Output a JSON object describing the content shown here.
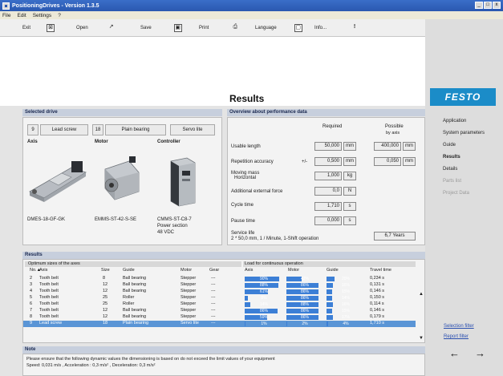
{
  "window": {
    "title": "PositioningDrives - Version 1.3.5",
    "min": "_",
    "max": "□",
    "close": "x"
  },
  "menu": [
    "File",
    "Edit",
    "Settings",
    "?"
  ],
  "toolbar": [
    {
      "label": "Exit",
      "icon": "⊠"
    },
    {
      "label": "Open",
      "icon": "↗"
    },
    {
      "label": "Save",
      "icon": "▣"
    },
    {
      "label": "Print",
      "icon": "⎙"
    },
    {
      "label": "Language",
      "icon": "▢"
    },
    {
      "label": "Info...",
      "icon": "!"
    }
  ],
  "brand": "FESTO",
  "page_title": "Results",
  "nav": [
    {
      "label": "Application",
      "state": "normal"
    },
    {
      "label": "System parameters",
      "state": "normal"
    },
    {
      "label": "Guide",
      "state": "normal"
    },
    {
      "label": "Results",
      "state": "active"
    },
    {
      "label": "Details",
      "state": "normal"
    },
    {
      "label": "Parts list",
      "state": "disabled"
    },
    {
      "label": "Project Data",
      "state": "disabled"
    }
  ],
  "links": {
    "selection_filter": "Selection filter",
    "report_filter": "Report filter"
  },
  "selected_drive": {
    "header": "Selected drive",
    "row": [
      "9",
      "Lead screw",
      "18",
      "Plain bearing",
      "Servo lite"
    ],
    "axis": {
      "title": "Axis",
      "part": "DMES-18-GF-GK"
    },
    "motor": {
      "title": "Motor",
      "part": "EMMS-ST-42-S-SE"
    },
    "controller": {
      "title": "Controller",
      "part": "CMMS-ST-C8-7",
      "line2": "Power section",
      "line3": "48 VDC"
    }
  },
  "performance": {
    "header": "Overview about performance data",
    "required_label": "Required",
    "possible_label": "Possible",
    "possible_sub": "by axis",
    "usable_length": {
      "label": "Usable length",
      "required": "50,000",
      "unit": "mm",
      "possible": "400,000",
      "possible_unit": "mm"
    },
    "repetition": {
      "label": "Repetition accuracy",
      "pm": "+/-",
      "required": "0,500",
      "unit": "mm",
      "possible": "0,050",
      "possible_unit": "mm"
    },
    "moving_mass": {
      "label1": "Moving mass",
      "label2": "Horizontal",
      "required": "1,000",
      "unit": "kg"
    },
    "ext_force": {
      "label": "Additional external force",
      "required": "0,0",
      "unit": "N"
    },
    "cycle_time": {
      "label": "Cycle time",
      "required": "1,710",
      "unit": "s"
    },
    "pause_time": {
      "label": "Pause time",
      "required": "0,000",
      "unit": "s"
    },
    "service_life": {
      "label1": "Service life",
      "label2": "2 * 50,0 mm, 1 / Minute, 1-Shift operation",
      "value": "6,7 Years"
    }
  },
  "results": {
    "header": "Results",
    "group_left": "Optimum sizes of the axes",
    "group_right": "Load for continuous operation",
    "columns": [
      "No.",
      "Axis",
      "Size",
      "Guide",
      "Motor",
      "Gear",
      "Axis",
      "Motor",
      "Guide",
      "Travel time"
    ],
    "rows": [
      {
        "no": "2",
        "axis": "Tooth belt",
        "size": "8",
        "guide": "Ball bearing",
        "motor": "Stepper",
        "gear": "---",
        "la": 90,
        "lm": 42,
        "lg": 20,
        "time": "0,234 s",
        "sel": false
      },
      {
        "no": "3",
        "axis": "Tooth belt",
        "size": "12",
        "guide": "Ball bearing",
        "motor": "Stepper",
        "gear": "---",
        "la": 88,
        "lm": 86,
        "lg": 16,
        "time": "0,131 s",
        "sel": false
      },
      {
        "no": "4",
        "axis": "Tooth belt",
        "size": "12",
        "guide": "Ball bearing",
        "motor": "Stepper",
        "gear": "---",
        "la": 61,
        "lm": 86,
        "lg": 15,
        "time": "0,146 s",
        "sel": false
      },
      {
        "no": "5",
        "axis": "Tooth belt",
        "size": "25",
        "guide": "Roller",
        "motor": "Stepper",
        "gear": "---",
        "la": 8,
        "lm": 86,
        "lg": 14,
        "time": "0,150 s",
        "sel": false
      },
      {
        "no": "6",
        "axis": "Tooth belt",
        "size": "25",
        "guide": "Roller",
        "motor": "Stepper",
        "gear": "---",
        "la": 14,
        "lm": 88,
        "lg": 16,
        "time": "0,114 s",
        "sel": false
      },
      {
        "no": "7",
        "axis": "Tooth belt",
        "size": "12",
        "guide": "Ball bearing",
        "motor": "Stepper",
        "gear": "---",
        "la": 86,
        "lm": 86,
        "lg": 15,
        "time": "0,146 s",
        "sel": false
      },
      {
        "no": "8",
        "axis": "Tooth belt",
        "size": "12",
        "guide": "Ball bearing",
        "motor": "Stepper",
        "gear": "---",
        "la": 59,
        "lm": 86,
        "lg": 17,
        "time": "0,179 s",
        "sel": false
      },
      {
        "no": "9",
        "axis": "Lead screw",
        "size": "18",
        "guide": "Plain bearing",
        "motor": "Servo lite",
        "gear": "---",
        "la": 1,
        "lm": 2,
        "lg": 4,
        "time": "1,710 s",
        "sel": true
      }
    ]
  },
  "note": {
    "header": "Note",
    "line1": "Please ensure that the following dynamic values the dimensioning is based on do not exceed the limit values of your equipment",
    "line2": "Speed: 0,031 m/s , Acceleration : 0,3 m/s² , Deceleration: 0,3 m/s²"
  },
  "colors": {
    "bar": "#3c7fd6",
    "selected_row": "#5a95d6",
    "brand": "#1b8cc8",
    "panel_header": "#c7cfdd"
  }
}
